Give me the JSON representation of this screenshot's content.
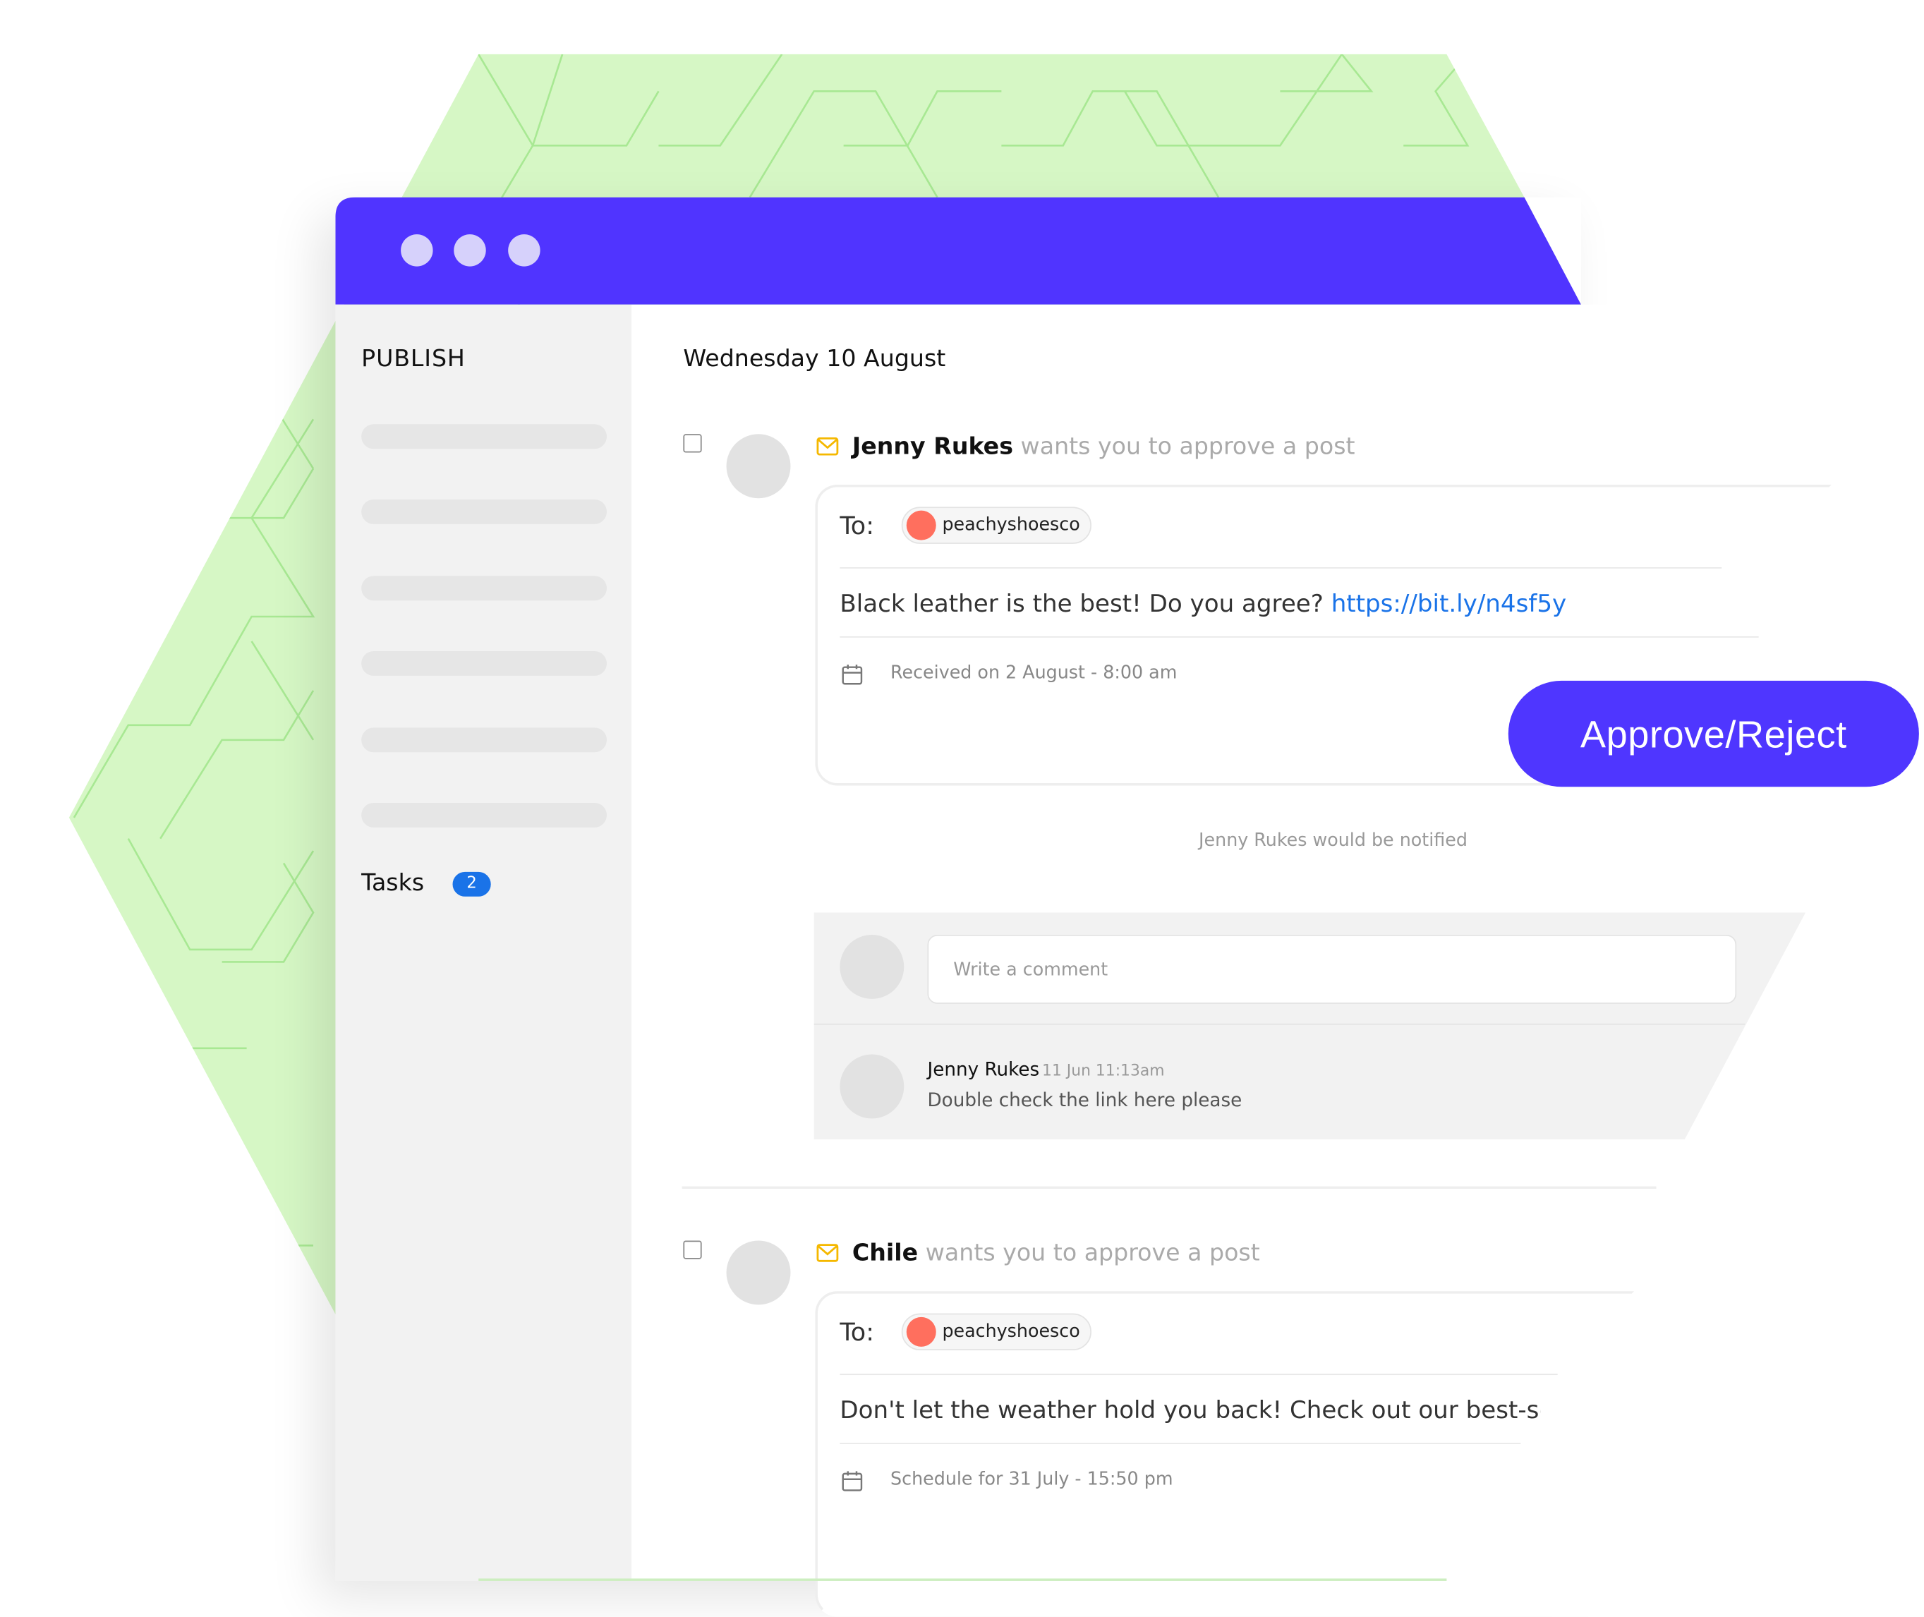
{
  "colors": {
    "titlebar": "#5034ff",
    "dots": "#d6d1fb",
    "hex_green": "#d6f7c5",
    "hex_lines": "#a8e893",
    "sidebar_bg": "#f2f2f2",
    "accent_blue": "#1a73e8",
    "approve_button": "#4f36ff",
    "chip_avatar": "#ff6f5e",
    "mail_icon": "#f5b800"
  },
  "sidebar": {
    "title": "PUBLISH",
    "tasks_label": "Tasks",
    "tasks_count": "2"
  },
  "main": {
    "date_heading": "Wednesday 10 August",
    "posts": [
      {
        "author": "Jenny Rukes",
        "action": "wants you to approve a post",
        "to_label": "To:",
        "recipient": "peachyshoesco",
        "text": "Black leather is the best! Do you agree? ",
        "link": "https://bit.ly/n4sf5y",
        "date_meta": "Received on 2 August - 8:00 am",
        "icon": "mail-icon"
      },
      {
        "author": "Chile",
        "action": "wants you to approve a post",
        "to_label": "To:",
        "recipient": "peachyshoesco",
        "text": "Don't let the weather hold you back! Check out our best-selling",
        "date_meta": "Schedule for 31 July - 15:50 pm",
        "icon": "mail-icon"
      }
    ],
    "approve_button": "Approve/Reject",
    "notified": "Jenny Rukes would be notified",
    "comments": {
      "placeholder": "Write a comment",
      "items": [
        {
          "author": "Jenny Rukes",
          "time": "11 Jun 11:13am",
          "text": "Double check the link here please"
        }
      ]
    }
  }
}
